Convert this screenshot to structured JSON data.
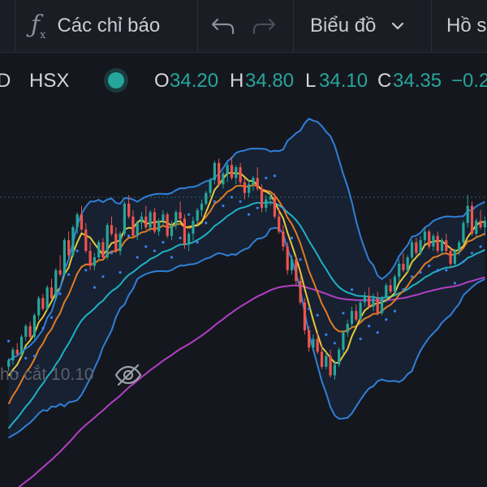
{
  "toolbar": {
    "indicators_label": "Các chỉ báo",
    "chart_menu_label": "Biểu đồ",
    "profile_label": "Hồ s"
  },
  "legend": {
    "symbol_fragment": "D",
    "exchange": "HSX",
    "open_label": "O",
    "open": "34.20",
    "high_label": "H",
    "high": "34.80",
    "low_label": "L",
    "low": "34.10",
    "close_label": "C",
    "close": "34.35",
    "change": "−0.2"
  },
  "annotation_text": "ho cắt 10.10",
  "colors": {
    "up": "#26a69a",
    "down": "#ef5350",
    "bollinger": "#2f7fd6",
    "ma_fast": "#e3c83c",
    "ma_mid": "#e07b24",
    "ma_slow": "#1fb0c4",
    "ma_long": "#b23fc2",
    "sar": "#3b7ff0"
  },
  "chart_data": {
    "type": "candlestick",
    "candles": [
      [
        30.1,
        30.5,
        29.9,
        30.4
      ],
      [
        30.4,
        31.0,
        30.2,
        30.9
      ],
      [
        30.9,
        31.2,
        30.6,
        30.7
      ],
      [
        30.7,
        31.6,
        30.6,
        31.5
      ],
      [
        31.5,
        32.1,
        31.3,
        32.0
      ],
      [
        32.0,
        32.2,
        31.4,
        31.5
      ],
      [
        31.5,
        32.6,
        31.4,
        32.5
      ],
      [
        32.5,
        33.4,
        32.3,
        33.3
      ],
      [
        33.3,
        33.5,
        32.7,
        32.8
      ],
      [
        32.8,
        33.9,
        32.7,
        33.8
      ],
      [
        33.8,
        34.2,
        33.2,
        33.3
      ],
      [
        33.3,
        34.7,
        33.2,
        34.6
      ],
      [
        34.6,
        35.3,
        34.3,
        34.4
      ],
      [
        34.4,
        36.1,
        34.3,
        36.0
      ],
      [
        36.0,
        36.4,
        35.2,
        35.3
      ],
      [
        35.3,
        36.7,
        35.2,
        36.6
      ],
      [
        36.6,
        37.3,
        36.3,
        37.2
      ],
      [
        37.2,
        37.6,
        36.4,
        36.5
      ],
      [
        36.5,
        36.8,
        35.4,
        35.5
      ],
      [
        35.5,
        35.9,
        34.6,
        34.8
      ],
      [
        34.8,
        35.4,
        34.6,
        35.2
      ],
      [
        35.2,
        36.0,
        35.1,
        35.9
      ],
      [
        35.9,
        36.1,
        35.1,
        35.2
      ],
      [
        35.2,
        36.8,
        35.1,
        36.7
      ],
      [
        36.7,
        37.1,
        36.2,
        36.3
      ],
      [
        36.3,
        36.6,
        35.4,
        35.5
      ],
      [
        35.5,
        36.4,
        35.3,
        36.3
      ],
      [
        36.3,
        37.8,
        36.2,
        37.7
      ],
      [
        37.7,
        38.1,
        37.0,
        37.1
      ],
      [
        37.1,
        37.4,
        36.1,
        36.2
      ],
      [
        36.2,
        36.9,
        36.0,
        36.8
      ],
      [
        36.8,
        37.3,
        36.5,
        37.1
      ],
      [
        37.1,
        37.6,
        36.5,
        36.6
      ],
      [
        36.6,
        37.4,
        36.4,
        37.3
      ],
      [
        37.3,
        37.5,
        36.3,
        36.4
      ],
      [
        36.4,
        37.0,
        36.2,
        36.9
      ],
      [
        36.9,
        37.4,
        36.7,
        37.2
      ],
      [
        37.2,
        37.3,
        36.1,
        36.2
      ],
      [
        36.2,
        36.9,
        36.0,
        36.7
      ],
      [
        36.7,
        37.4,
        36.5,
        37.3
      ],
      [
        37.3,
        37.8,
        36.9,
        37.0
      ],
      [
        37.0,
        37.2,
        35.6,
        35.8
      ],
      [
        35.8,
        36.4,
        35.5,
        36.3
      ],
      [
        36.3,
        37.1,
        36.0,
        36.9
      ],
      [
        36.9,
        37.5,
        36.7,
        37.4
      ],
      [
        37.4,
        37.9,
        37.1,
        37.7
      ],
      [
        37.7,
        38.3,
        37.6,
        38.2
      ],
      [
        38.2,
        38.9,
        38.0,
        38.8
      ],
      [
        38.8,
        39.7,
        38.6,
        39.6
      ],
      [
        39.6,
        39.8,
        38.5,
        38.6
      ],
      [
        38.6,
        39.2,
        38.4,
        39.1
      ],
      [
        39.1,
        39.6,
        38.7,
        39.5
      ],
      [
        39.5,
        39.9,
        38.8,
        38.9
      ],
      [
        38.9,
        39.5,
        38.6,
        39.4
      ],
      [
        39.4,
        39.6,
        38.6,
        38.7
      ],
      [
        38.7,
        38.9,
        37.9,
        38.2
      ],
      [
        38.2,
        38.8,
        38.0,
        38.6
      ],
      [
        38.6,
        39.0,
        38.3,
        38.9
      ],
      [
        38.9,
        39.4,
        38.3,
        38.4
      ],
      [
        38.4,
        38.6,
        37.3,
        37.5
      ],
      [
        37.5,
        38.1,
        37.3,
        37.9
      ],
      [
        37.9,
        38.2,
        37.6,
        38.0
      ],
      [
        38.0,
        38.2,
        37.0,
        37.1
      ],
      [
        37.1,
        37.5,
        36.3,
        36.4
      ],
      [
        36.4,
        36.7,
        35.5,
        35.7
      ],
      [
        35.7,
        35.9,
        34.4,
        34.6
      ],
      [
        34.6,
        35.3,
        34.4,
        35.1
      ],
      [
        35.1,
        35.3,
        33.9,
        34.1
      ],
      [
        34.1,
        34.3,
        33.0,
        33.1
      ],
      [
        33.1,
        33.3,
        31.6,
        31.8
      ],
      [
        31.8,
        32.0,
        30.8,
        31.0
      ],
      [
        31.0,
        31.6,
        30.8,
        31.4
      ],
      [
        31.4,
        31.7,
        30.7,
        30.8
      ],
      [
        30.8,
        31.1,
        30.0,
        30.1
      ],
      [
        30.1,
        30.8,
        30.0,
        30.6
      ],
      [
        30.6,
        30.9,
        29.6,
        29.7
      ],
      [
        29.7,
        30.4,
        29.5,
        30.2
      ],
      [
        30.2,
        31.0,
        30.1,
        30.9
      ],
      [
        30.9,
        31.8,
        30.7,
        31.7
      ],
      [
        31.7,
        32.3,
        31.5,
        32.1
      ],
      [
        32.1,
        32.9,
        31.9,
        32.7
      ],
      [
        32.7,
        33.0,
        32.2,
        32.3
      ],
      [
        32.3,
        33.2,
        32.2,
        33.1
      ],
      [
        33.1,
        33.6,
        32.9,
        33.4
      ],
      [
        33.4,
        33.8,
        32.8,
        32.9
      ],
      [
        32.9,
        33.5,
        32.7,
        33.3
      ],
      [
        33.3,
        33.6,
        32.5,
        32.6
      ],
      [
        32.6,
        33.4,
        32.5,
        33.3
      ],
      [
        33.3,
        34.0,
        33.1,
        33.9
      ],
      [
        33.9,
        34.2,
        33.5,
        33.6
      ],
      [
        33.6,
        34.4,
        33.5,
        34.3
      ],
      [
        34.3,
        35.1,
        34.1,
        34.9
      ],
      [
        34.9,
        35.4,
        34.5,
        34.6
      ],
      [
        34.6,
        35.3,
        34.5,
        35.2
      ],
      [
        35.2,
        36.0,
        35.1,
        35.9
      ],
      [
        35.9,
        36.1,
        35.3,
        35.4
      ],
      [
        35.4,
        36.2,
        35.3,
        36.0
      ],
      [
        36.0,
        36.6,
        35.8,
        36.4
      ],
      [
        36.4,
        36.5,
        35.6,
        35.7
      ],
      [
        35.7,
        36.3,
        35.5,
        36.2
      ],
      [
        36.2,
        36.4,
        35.4,
        35.5
      ],
      [
        35.5,
        36.1,
        35.3,
        36.0
      ],
      [
        36.0,
        36.3,
        35.4,
        35.5
      ],
      [
        35.5,
        35.7,
        34.7,
        34.9
      ],
      [
        34.9,
        35.6,
        34.8,
        35.5
      ],
      [
        35.5,
        36.0,
        35.3,
        35.9
      ],
      [
        35.9,
        36.9,
        35.8,
        36.8
      ],
      [
        36.8,
        38.1,
        36.6,
        37.6
      ],
      [
        37.6,
        37.8,
        36.2,
        36.3
      ],
      [
        36.3,
        37.0,
        36.1,
        36.9
      ],
      [
        36.9,
        37.4,
        36.5,
        36.6
      ],
      [
        36.6,
        37.1,
        36.2,
        36.9
      ]
    ]
  }
}
